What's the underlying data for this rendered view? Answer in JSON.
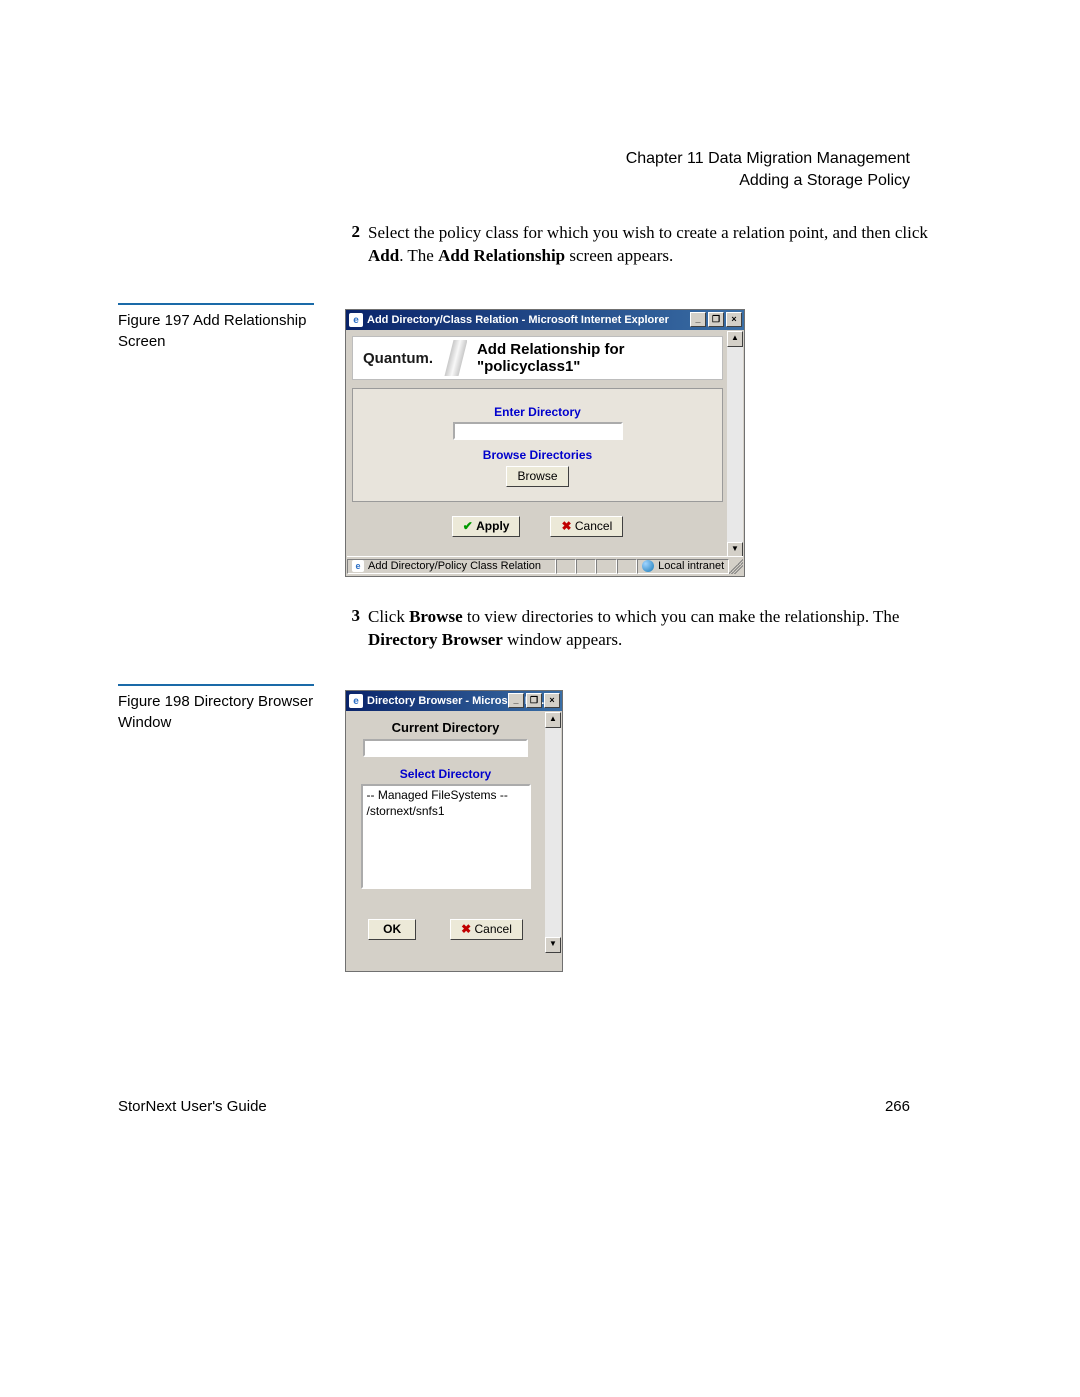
{
  "header": {
    "chapter_line": "Chapter 11  Data Migration Management",
    "section_line": "Adding a Storage Policy"
  },
  "step2": {
    "num": "2",
    "text_a": "Select the policy class for which you wish to create a relation point, and then click ",
    "bold_a": "Add",
    "text_b": ". The ",
    "bold_b": "Add Relationship",
    "text_c": " screen appears."
  },
  "fig197": {
    "caption": "Figure 197  Add Relationship Screen",
    "title": "Add Directory/Class Relation - Microsoft Internet Explorer",
    "brand": "Quantum.",
    "banner_title": "Add Relationship for \"policyclass1\"",
    "enter_dir_label": "Enter Directory",
    "browse_dirs_label": "Browse Directories",
    "browse_button": "Browse",
    "apply_button": "Apply",
    "cancel_button": "Cancel",
    "status_addr": "Add Directory/Policy Class Relation",
    "status_zone": "Local intranet"
  },
  "step3": {
    "num": "3",
    "text_a": "Click ",
    "bold_a": "Browse",
    "text_b": " to view directories to which you can make the relationship. The ",
    "bold_b": "Directory Browser",
    "text_c": " window appears."
  },
  "fig198": {
    "caption": "Figure 198  Directory Browser Window",
    "title": "Directory Browser - Microsoft Int...",
    "current_dir_heading": "Current Directory",
    "select_dir_label": "Select Directory",
    "list_line1": "-- Managed FileSystems --",
    "list_line2": "/stornext/snfs1",
    "ok_button": "OK",
    "cancel_button": "Cancel"
  },
  "footer": {
    "guide": "StorNext User's Guide",
    "page": "266"
  }
}
